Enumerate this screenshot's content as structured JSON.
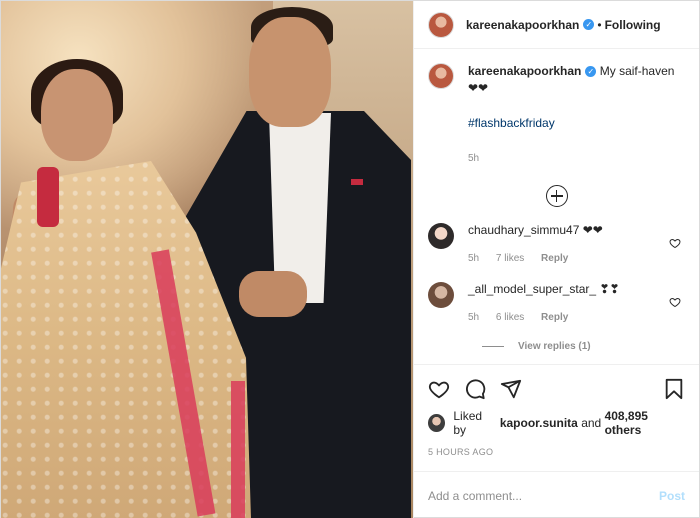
{
  "author": {
    "username": "kareenakapoorkhan",
    "verified": true,
    "follow_status": "Following",
    "separator": "•"
  },
  "caption": {
    "username": "kareenakapoorkhan",
    "text": "My saif-haven ❤❤",
    "hashtag": "#flashbackfriday",
    "time": "5h"
  },
  "comments": [
    {
      "username": "chaudhary_simmu47",
      "text": "❤❤",
      "time": "5h",
      "likes": "7 likes",
      "reply": "Reply"
    },
    {
      "username": "_all_model_super_star_",
      "text": "❣❣",
      "time": "5h",
      "likes": "6 likes",
      "reply": "Reply"
    }
  ],
  "view_replies": "View replies (1)",
  "likes": {
    "prefix": "Liked by",
    "user": "kapoor.sunita",
    "conjunction": "and",
    "count": "408,895 others"
  },
  "timestamp": "5 HOURS AGO",
  "add_comment": {
    "placeholder": "Add a comment...",
    "post_label": "Post"
  },
  "icons": {
    "like": "heart-icon",
    "comment": "comment-icon",
    "share": "share-icon",
    "save": "bookmark-icon",
    "more": "plus-circle-icon"
  },
  "colors": {
    "verified": "#3897f0",
    "hashtag": "#00376b",
    "muted": "#8e8e8e",
    "post_disabled": "#b2dffc"
  }
}
